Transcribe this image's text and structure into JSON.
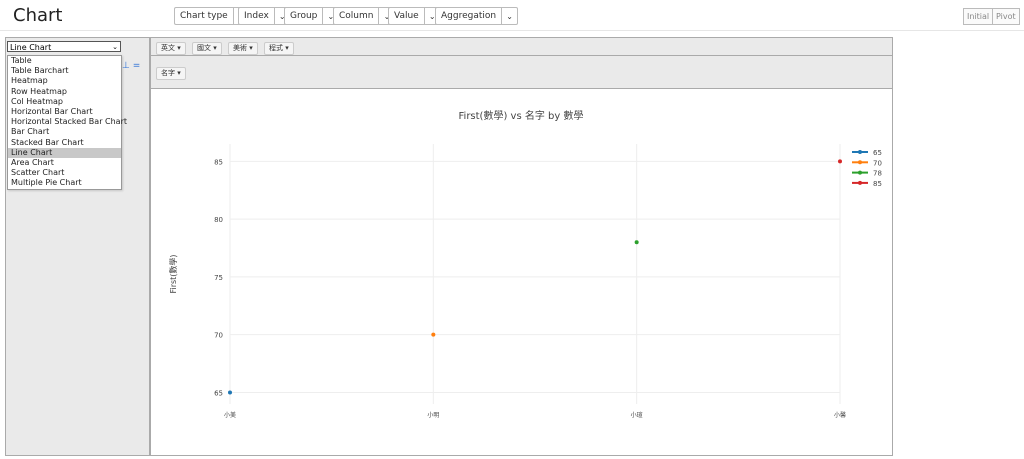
{
  "app": {
    "title": "Chart"
  },
  "controls": [
    {
      "label": "Chart type"
    },
    {
      "label": "Index"
    },
    {
      "label": "Group"
    },
    {
      "label": "Column"
    },
    {
      "label": "Value"
    },
    {
      "label": "Aggregation"
    }
  ],
  "buttons": {
    "initial": "Initial",
    "pivot": "Pivot"
  },
  "chart_type_select": {
    "value": "Line Chart",
    "options": [
      "Table",
      "Table Barchart",
      "Heatmap",
      "Row Heatmap",
      "Col Heatmap",
      "Horizontal Bar Chart",
      "Horizontal Stacked Bar Chart",
      "Bar Chart",
      "Stacked Bar Chart",
      "Line Chart",
      "Area Chart",
      "Scatter Chart",
      "Multiple Pie Chart"
    ],
    "selected_index": 9
  },
  "attributes": [
    "英文 ▾",
    "國文 ▾",
    "美術 ▾",
    "程式 ▾"
  ],
  "column_attrs": [
    "名字 ▾"
  ],
  "chart_data": {
    "type": "line",
    "title": "First(數學) vs 名字 by 數學",
    "ylabel": "First(數學)",
    "xlabel": "",
    "categories": [
      "小美",
      "小明",
      "小瑄",
      "小馨"
    ],
    "yticks": [
      65,
      70,
      75,
      80,
      85
    ],
    "ylim": [
      64,
      86.5
    ],
    "series": [
      {
        "name": "65",
        "color": "#1f77b4",
        "points": [
          {
            "x": "小美",
            "y": 65
          }
        ]
      },
      {
        "name": "70",
        "color": "#ff7f0e",
        "points": [
          {
            "x": "小明",
            "y": 70
          }
        ]
      },
      {
        "name": "78",
        "color": "#2ca02c",
        "points": [
          {
            "x": "小瑄",
            "y": 78
          }
        ]
      },
      {
        "name": "85",
        "color": "#d62728",
        "points": [
          {
            "x": "小馨",
            "y": 85
          }
        ]
      }
    ],
    "legend": "top-right",
    "grid": true
  }
}
